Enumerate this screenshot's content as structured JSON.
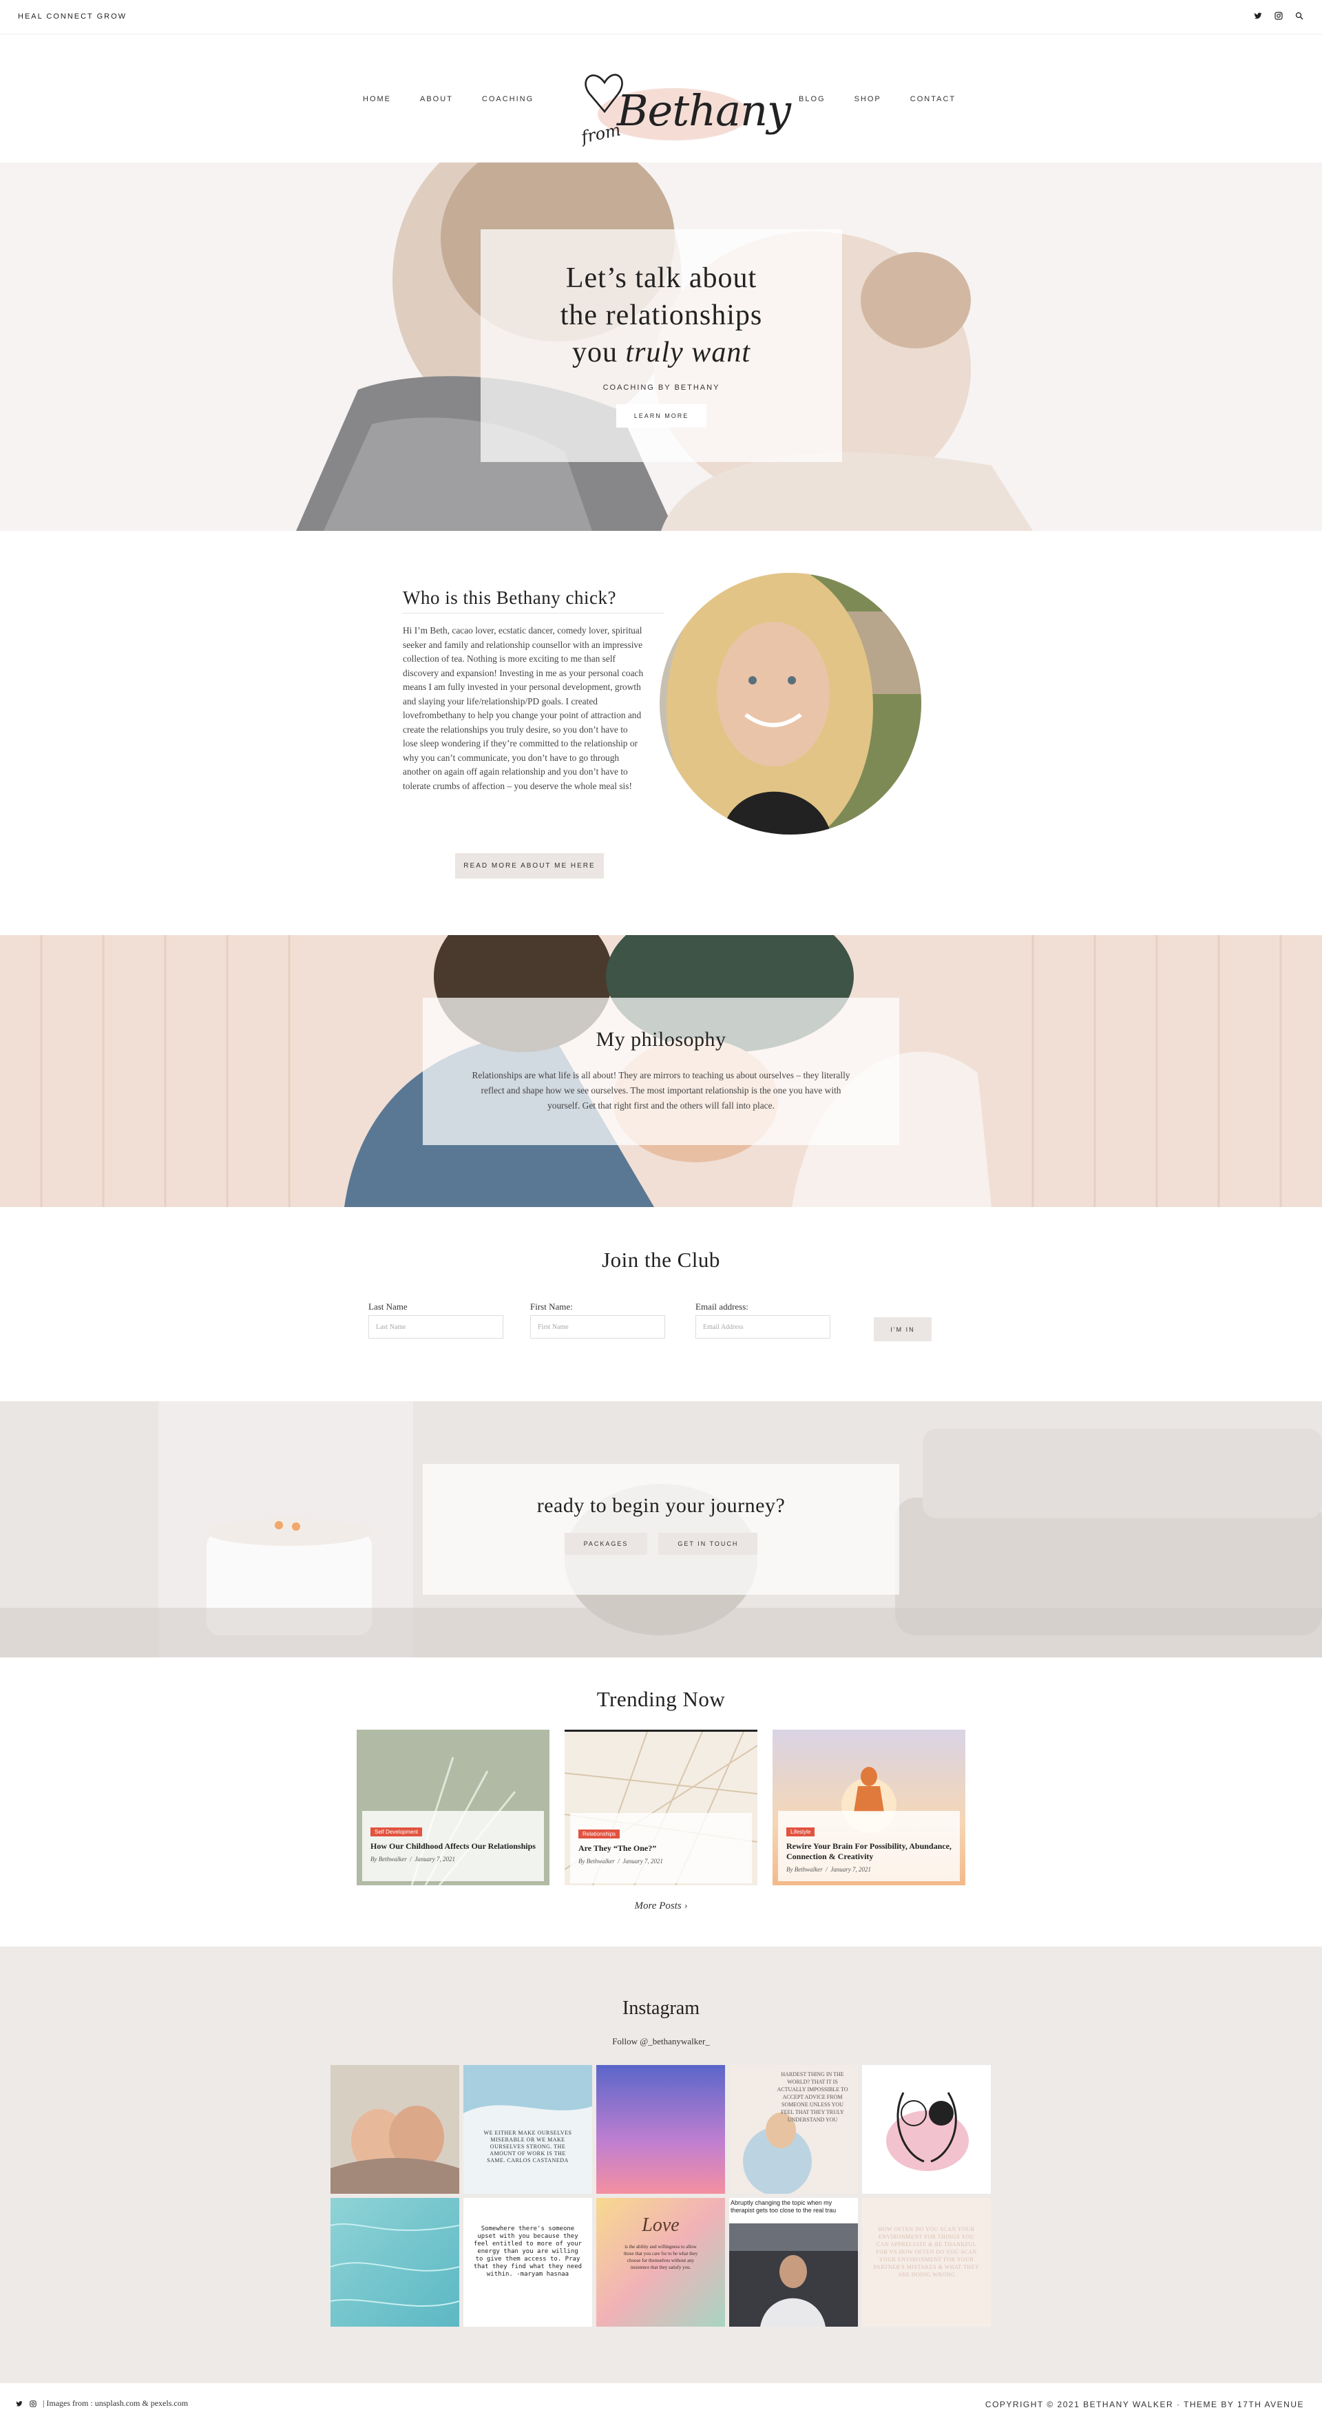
{
  "topbar": {
    "tagline": "HEAL CONNECT GROW",
    "icons": [
      "twitter-icon",
      "instagram-icon",
      "search-icon"
    ]
  },
  "nav": {
    "left": [
      "HOME",
      "ABOUT",
      "COACHING"
    ],
    "right": [
      "BLOG",
      "SHOP",
      "CONTACT"
    ]
  },
  "logo": {
    "script_main": "Bethany",
    "script_small": "from"
  },
  "hero": {
    "line1": "Let’s talk about",
    "line2": "the relationships",
    "line3_a": "you",
    "line3_b": "truly want",
    "subtitle": "COACHING BY BETHANY",
    "button": "LEARN MORE"
  },
  "about": {
    "title": "Who is this Bethany chick?",
    "body": "Hi I’m Beth, cacao lover, ecstatic dancer, comedy lover, spiritual seeker and family and relationship counsellor with an impressive collection of tea. Nothing is more exciting to me than self discovery and expansion! Investing in me as your personal coach means I am fully invested in your personal development, growth and slaying your life/relationship/PD goals. I created lovefrombethany to help you change your point of attraction and create the relationships you truly desire, so you don’t have to lose sleep wondering if they’re committed to the relationship or why you can’t communicate, you don’t have to go through another on again off again relationship and you don’t have to tolerate crumbs of affection – you deserve the whole meal sis!",
    "button": "READ MORE ABOUT ME HERE"
  },
  "philosophy": {
    "title": "My philosophy",
    "body": "Relationships are what life is all about! They are mirrors to teaching us about ourselves – they literally reflect and shape how we see ourselves. The most important relationship is the one you have with yourself. Get that right first and the others will fall into place."
  },
  "club": {
    "title": "Join the Club",
    "fields": [
      {
        "label": "Last Name",
        "placeholder": "Last Name"
      },
      {
        "label": "First Name:",
        "placeholder": "First Name"
      },
      {
        "label": "Email address:",
        "placeholder": "Email Address"
      }
    ],
    "button": "I'M IN"
  },
  "journey": {
    "title": "ready to begin your journey?",
    "buttons": [
      "PACKAGES",
      "GET IN TOUCH"
    ]
  },
  "trending": {
    "title": "Trending Now",
    "posts": [
      {
        "category": "Self Development",
        "title": "How Our Childhood Affects Our Relationships",
        "author": "By Bethwalker",
        "date": "January 7, 2021"
      },
      {
        "category": "Relationships",
        "title": "Are They “The One?”",
        "author": "By Bethwalker",
        "date": "January 7, 2021"
      },
      {
        "category": "Lifestyle",
        "title": "Rewire Your Brain For Possibility, Abundance, Connection & Creativity",
        "author": "By Bethwalker",
        "date": "January 7, 2021"
      }
    ],
    "more": "More Posts ›"
  },
  "instagram": {
    "title": "Instagram",
    "follow": "Follow @_bethanywalker_",
    "tile_texts": {
      "t2": "WE EITHER MAKE OURSELVES MISERABLE OR WE MAKE OURSELVES STRONG. THE AMOUNT OF WORK IS THE SAME. CARLOS CASTANEDA",
      "t4": "HARDEST THING IN THE WORLD? THAT IT IS ACTUALLY IMPOSSIBLE TO ACCEPT ADVICE FROM SOMEONE UNLESS YOU FEEL THAT THEY TRULY UNDERSTAND YOU",
      "t6_title": "Somewhere there's someone upset with you because they feel entitled to more of your energy than you are willing to give them access to. Pray that they find what they need within. -maryam hasnaa",
      "t7_script": "Love",
      "t7": "is the ability and willingness to allow those that you care for to be what they choose for themselves without any insistence that they satisfy you.",
      "t8": "Abruptly changing the topic when my therapist gets too close to the real trau",
      "t9": "HOW OFTEN DO YOU SCAN YOUR ENVIRONMENT FOR THINGS YOU CAN APPRECIATE & BE THANKFUL FOR VS HOW OFTEN DO YOU SCAN YOUR ENVIRONMENT FOR YOUR PARTNER'S MISTAKES & WHAT THEY ARE DOING WRONG"
    }
  },
  "footer": {
    "credit": "| Images from : unsplash.com & pexels.com",
    "copyright": "COPYRIGHT © 2021 BETHANY WALKER · THEME BY 17TH AVENUE"
  },
  "colors": {
    "accent_pink": "#f3d4cc",
    "badge_red": "#e2533f",
    "ig_bg": "#eeeae7",
    "button_grey": "#ebe6e3"
  }
}
